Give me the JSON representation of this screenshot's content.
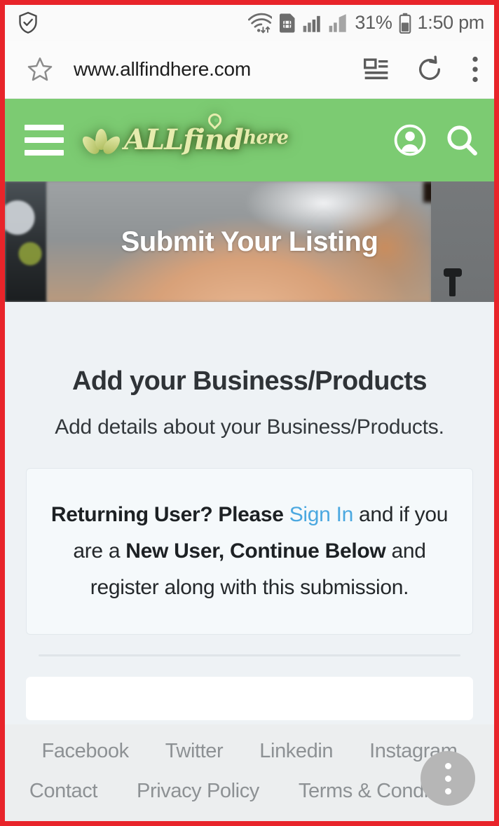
{
  "status_bar": {
    "security_icon": "shield-check-icon",
    "wifi_icon": "wifi-data-icon",
    "sim_icon": "sim-card-icon",
    "signal_icon_1": "signal-bars-icon",
    "signal_icon_2": "signal-bars-weak-icon",
    "battery_percent": "31%",
    "battery_icon": "battery-icon",
    "time": "1:50 pm"
  },
  "browser_bar": {
    "bookmark_icon": "star-icon",
    "url": "www.allfindhere.com",
    "reader_icon": "reader-view-icon",
    "refresh_icon": "refresh-icon",
    "menu_icon": "three-dot-menu-icon"
  },
  "site_header": {
    "menu_icon": "hamburger-menu-icon",
    "logo_main": "ALLfind",
    "logo_suffix": "here",
    "logo_leaf_icon": "leaf-icon",
    "logo_pin_icon": "location-pin-icon",
    "account_icon": "user-account-icon",
    "search_icon": "search-icon",
    "brand_color": "#7ccb72"
  },
  "hero": {
    "title": "Submit Your Listing"
  },
  "main": {
    "heading": "Add your Business/Products",
    "subheading": "Add details about your Business/Products.",
    "info_card": {
      "part1": "Returning User? Please ",
      "link": "Sign In",
      "part2": " and if you are a ",
      "bold": "New User, Continue Below",
      "part3": " and register along with this submission.",
      "link_color": "#4ba8e0"
    }
  },
  "footer": {
    "social_links": [
      "Facebook",
      "Twitter",
      "Linkedin",
      "Instagram"
    ],
    "page_links": [
      "Contact",
      "Privacy Policy",
      "Terms & Conditions"
    ],
    "fab_icon": "three-dot-vertical-icon"
  }
}
